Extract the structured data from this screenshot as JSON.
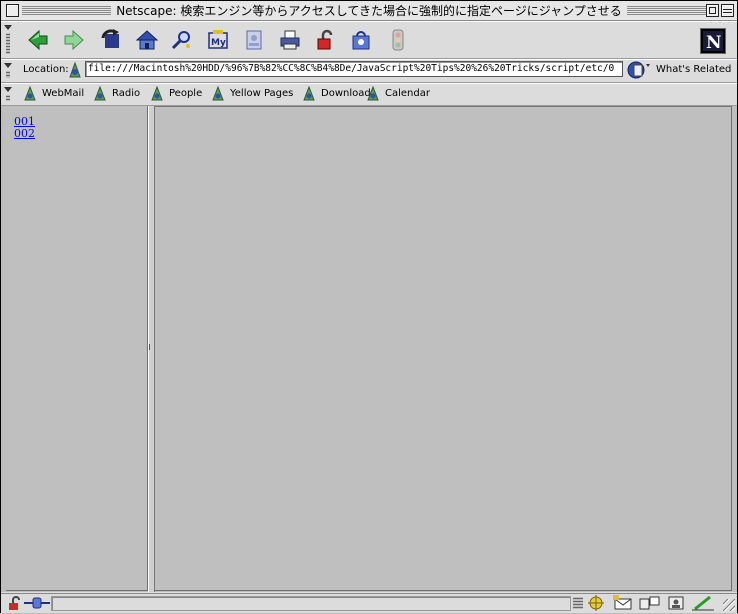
{
  "window": {
    "title": "Netscape: 検索エンジン等からアクセスしてきた場合に強制的に指定ページにジャンプさせる"
  },
  "navbar": {
    "buttons": [
      {
        "name": "back-button",
        "icon": "back-arrow-icon"
      },
      {
        "name": "forward-button",
        "icon": "forward-arrow-icon"
      },
      {
        "name": "reload-button",
        "icon": "reload-icon"
      },
      {
        "name": "home-button",
        "icon": "home-icon"
      },
      {
        "name": "search-button",
        "icon": "search-icon"
      },
      {
        "name": "my-netscape-button",
        "icon": "my-netscape-icon"
      },
      {
        "name": "images-button",
        "icon": "images-icon"
      },
      {
        "name": "print-button",
        "icon": "print-icon"
      },
      {
        "name": "security-button",
        "icon": "lock-icon"
      },
      {
        "name": "shop-button",
        "icon": "shop-icon"
      },
      {
        "name": "stop-button",
        "icon": "stop-icon"
      }
    ]
  },
  "location": {
    "label": "Location:",
    "url": "file:///Macintosh%20HDD/%96%7B%82%CC%8C%B4%8De/JavaScript%20Tips%20%26%20Tricks/script/etc/0",
    "whats_related": "What's Related"
  },
  "personal_toolbar": {
    "items": [
      "WebMail",
      "Radio",
      "People",
      "Yellow Pages",
      "Download",
      "Calendar"
    ]
  },
  "left_frame": {
    "links": [
      "001",
      "002"
    ]
  },
  "colors": {
    "link": "#0000ee",
    "frame_bg": "#bfbfbf",
    "chrome": "#dcdcdc"
  }
}
